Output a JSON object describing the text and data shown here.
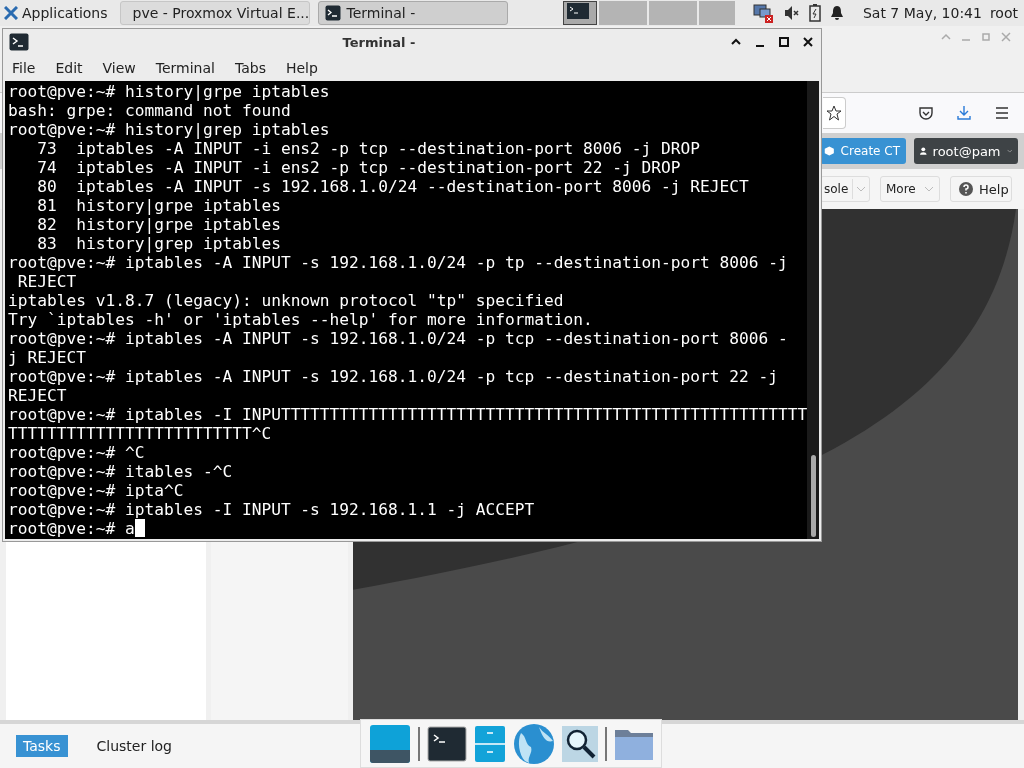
{
  "top_panel": {
    "applications": "Applications",
    "tasks": [
      {
        "label": "pve - Proxmox Virtual E...",
        "kind": "browser",
        "selected": false
      },
      {
        "label": "Terminal -",
        "kind": "terminal",
        "selected": true
      }
    ],
    "clock": "Sat  7 May, 10:41",
    "user": "root"
  },
  "browser": {
    "create_button": "Create CT",
    "user_menu": "root@pam",
    "toolbar_buttons": [
      {
        "label": "sole",
        "kind": "split"
      },
      {
        "label": "More",
        "kind": "menu"
      },
      {
        "label": "Help",
        "kind": "help"
      }
    ],
    "bottom_tabs": [
      {
        "label": "Tasks",
        "selected": true
      },
      {
        "label": "Cluster log",
        "selected": false
      }
    ]
  },
  "terminal": {
    "title": "Terminal -",
    "menu": [
      "File",
      "Edit",
      "View",
      "Terminal",
      "Tabs",
      "Help"
    ],
    "lines": [
      "root@pve:~# history|grpe iptables",
      "bash: grpe: command not found",
      "root@pve:~# history|grep iptables",
      "   73  iptables -A INPUT -i ens2 -p tcp --destination-port 8006 -j DROP",
      "   74  iptables -A INPUT -i ens2 -p tcp --destination-port 22 -j DROP",
      "   80  iptables -A INPUT -s 192.168.1.0/24 --destination-port 8006 -j REJECT",
      "   81  history|grpe iptables",
      "   82  history|grpe iptables",
      "   83  history|grep iptables",
      "root@pve:~# iptables -A INPUT -s 192.168.1.0/24 -p tp --destination-port 8006 -j",
      " REJECT",
      "iptables v1.8.7 (legacy): unknown protocol \"tp\" specified",
      "Try `iptables -h' or 'iptables --help' for more information.",
      "root@pve:~# iptables -A INPUT -s 192.168.1.0/24 -p tcp --destination-port 8006 -",
      "j REJECT",
      "root@pve:~# iptables -A INPUT -s 192.168.1.0/24 -p tcp --destination-port 22 -j",
      "REJECT",
      "root@pve:~# iptables -I INPUTTTTTTTTTTTTTTTTTTTTTTTTTTTTTTTTTTTTTTTTTTTTTTTTTTTTTT",
      "TTTTTTTTTTTTTTTTTTTTTTTTT^C",
      "root@pve:~# ^C",
      "root@pve:~# itables -^C",
      "root@pve:~# ipta^C",
      "root@pve:~# iptables -I INPUT -s 192.168.1.1 -j ACCEPT",
      "root@pve:~# a"
    ]
  }
}
